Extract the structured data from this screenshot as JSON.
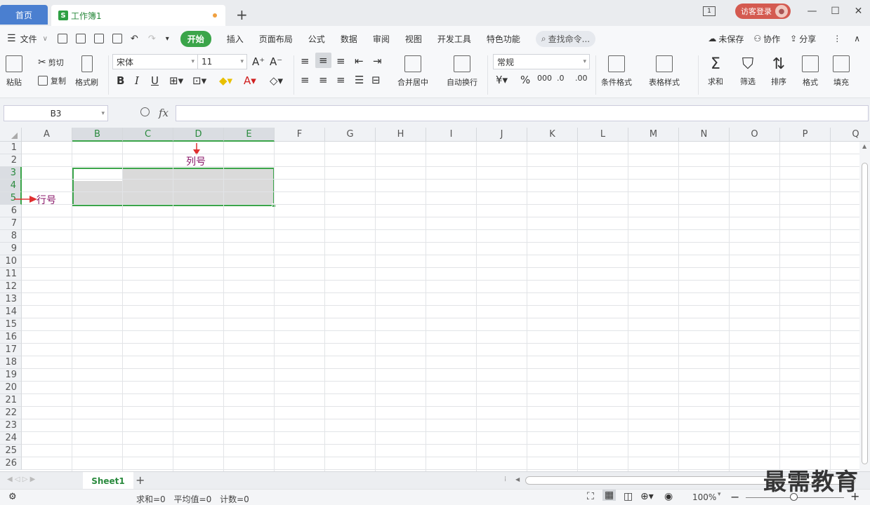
{
  "tabs": {
    "home": "首页",
    "doc": "工作簿1",
    "doc_icon": "S",
    "new": "+"
  },
  "window": {
    "page_ind": "1",
    "login": "访客登录",
    "min": "—",
    "max": "☐",
    "close": "✕"
  },
  "menu": {
    "file": "文件",
    "items": [
      "开始",
      "插入",
      "页面布局",
      "公式",
      "数据",
      "审阅",
      "视图",
      "开发工具",
      "特色功能"
    ],
    "search": "查找命令...",
    "unsaved": "未保存",
    "collab": "协作",
    "share": "分享"
  },
  "ribbon": {
    "paste": "粘贴",
    "cut": "剪切",
    "copy": "复制",
    "format_painter": "格式刷",
    "font_name": "宋体",
    "font_size": "11",
    "merge": "合并居中",
    "wrap": "自动换行",
    "number_format": "常规",
    "cond_format": "条件格式",
    "table_style": "表格样式",
    "sum": "求和",
    "filter": "筛选",
    "sort": "排序",
    "format": "格式",
    "fill": "填充"
  },
  "formula": {
    "namebox": "B3",
    "fx": "fx"
  },
  "grid": {
    "columns": [
      "A",
      "B",
      "C",
      "D",
      "E",
      "F",
      "G",
      "H",
      "I",
      "J",
      "K",
      "L",
      "M",
      "N",
      "O",
      "P",
      "Q"
    ],
    "rows": [
      "1",
      "2",
      "3",
      "4",
      "5",
      "6",
      "7",
      "8",
      "9",
      "10",
      "11",
      "12",
      "13",
      "14",
      "15",
      "16",
      "17",
      "18",
      "19",
      "20",
      "21",
      "22",
      "23",
      "24",
      "25",
      "26"
    ],
    "annot_col": "列号",
    "annot_row": "行号"
  },
  "sheets": {
    "name": "Sheet1",
    "add": "+"
  },
  "status": {
    "sum": "求和=0",
    "avg": "平均值=0",
    "count": "计数=0",
    "zoom": "100%"
  },
  "watermark": "最需教育",
  "colors": {
    "accent": "#3ba54a",
    "home_tab": "#4a7fd0",
    "annotation": "#8b1a6b",
    "arrow": "#e03030"
  }
}
